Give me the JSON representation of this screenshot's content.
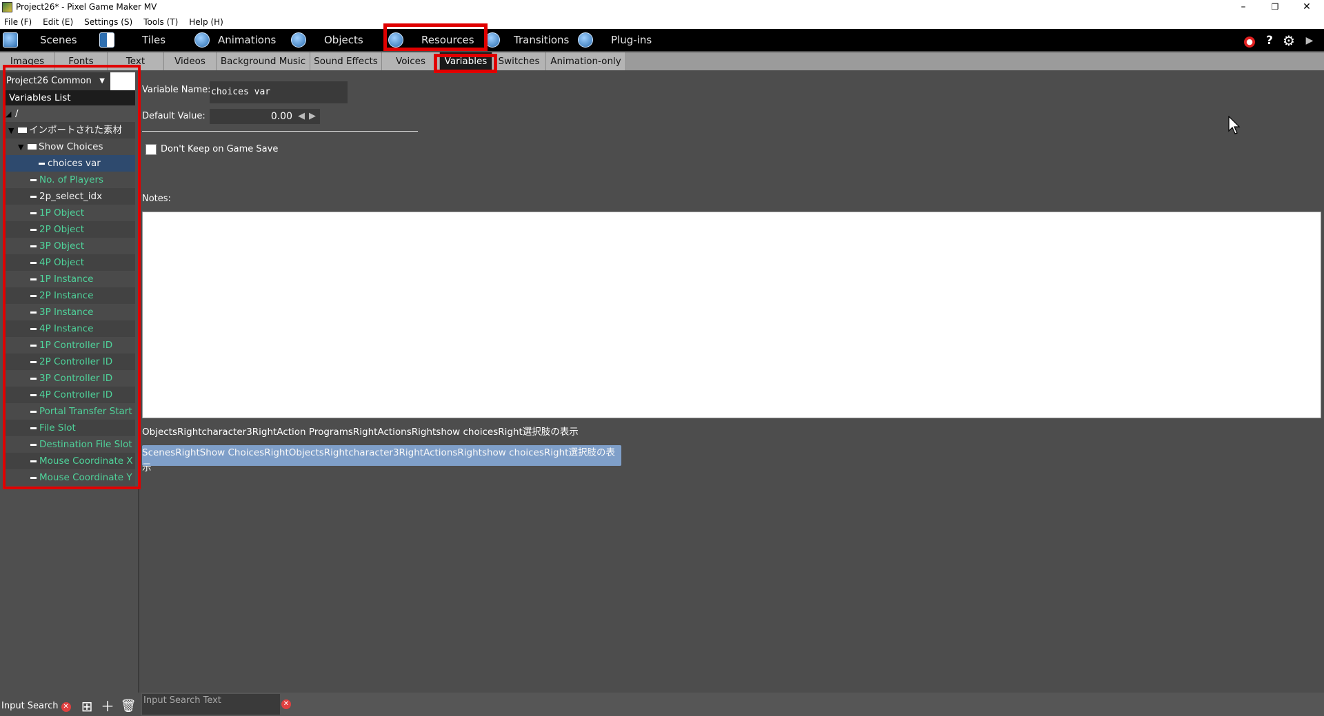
{
  "window": {
    "title": "Project26* - Pixel Game Maker MV",
    "minimize": "–",
    "restore": "❐",
    "close": "✕"
  },
  "menu": [
    "File (F)",
    "Edit (E)",
    "Settings (S)",
    "Tools (T)",
    "Help (H)"
  ],
  "main_tabs": [
    "Scenes",
    "Tiles",
    "Animations",
    "Objects",
    "Resources",
    "Transitions",
    "Plug-ins"
  ],
  "main_tabs_active": "Resources",
  "toolbar_icons": [
    "stop-icon",
    "help-icon",
    "gear-icon",
    "play-icon"
  ],
  "sub_tabs": [
    "Images",
    "Fonts",
    "Text",
    "Videos",
    "Background Music",
    "Sound Effects",
    "Voices",
    "Variables",
    "Switches",
    "Animation-only"
  ],
  "sub_tabs_active": "Variables",
  "left": {
    "project": "Project26 Common",
    "list_header": "Variables List",
    "root": "/",
    "tree": [
      {
        "label": "インポートされた素材",
        "type": "folder",
        "expanded": true,
        "color": "white"
      },
      {
        "label": "Show Choices",
        "type": "folder",
        "expanded": true,
        "color": "white"
      },
      {
        "label": "choices var",
        "type": "item",
        "selected": true,
        "color": "white"
      },
      {
        "label": "No. of Players",
        "type": "item",
        "color": "green"
      },
      {
        "label": "2p_select_idx",
        "type": "item",
        "color": "white"
      },
      {
        "label": "1P Object",
        "type": "item",
        "color": "green"
      },
      {
        "label": "2P Object",
        "type": "item",
        "color": "green"
      },
      {
        "label": "3P Object",
        "type": "item",
        "color": "green"
      },
      {
        "label": "4P Object",
        "type": "item",
        "color": "green"
      },
      {
        "label": "1P Instance",
        "type": "item",
        "color": "green"
      },
      {
        "label": "2P Instance",
        "type": "item",
        "color": "green"
      },
      {
        "label": "3P Instance",
        "type": "item",
        "color": "green"
      },
      {
        "label": "4P Instance",
        "type": "item",
        "color": "green"
      },
      {
        "label": "1P Controller ID",
        "type": "item",
        "color": "green"
      },
      {
        "label": "2P Controller ID",
        "type": "item",
        "color": "green"
      },
      {
        "label": "3P Controller ID",
        "type": "item",
        "color": "green"
      },
      {
        "label": "4P Controller ID",
        "type": "item",
        "color": "green"
      },
      {
        "label": "Portal Transfer Start",
        "type": "item",
        "color": "green"
      },
      {
        "label": "File Slot",
        "type": "item",
        "color": "green"
      },
      {
        "label": "Destination File Slot",
        "type": "item",
        "color": "green"
      },
      {
        "label": "Mouse Coordinate X",
        "type": "item",
        "color": "green"
      },
      {
        "label": "Mouse Coordinate Y",
        "type": "item",
        "color": "green"
      }
    ],
    "search_label": "Input Search"
  },
  "form": {
    "variable_name_label": "Variable Name:",
    "variable_name_value": "choices var",
    "default_value_label": "Default Value:",
    "default_value": "0.00",
    "dont_keep_label": "Don't Keep on Game Save",
    "dont_keep_checked": false,
    "notes_label": "Notes:",
    "notes_value": ""
  },
  "references": [
    "ObjectsRightcharacter3RightAction ProgramsRightActionsRightshow choicesRight選択肢の表示",
    "ScenesRightShow ChoicesRightObjectsRightcharacter3RightActionsRightshow choicesRight選択肢の表示"
  ],
  "bottom": {
    "search_placeholder": "Input Search Text"
  },
  "colors": {
    "highlight": "#e00000",
    "green_text": "#4fd29a",
    "selected_row": "#2e4a6e",
    "reference_highlight": "#7f9fc9"
  }
}
